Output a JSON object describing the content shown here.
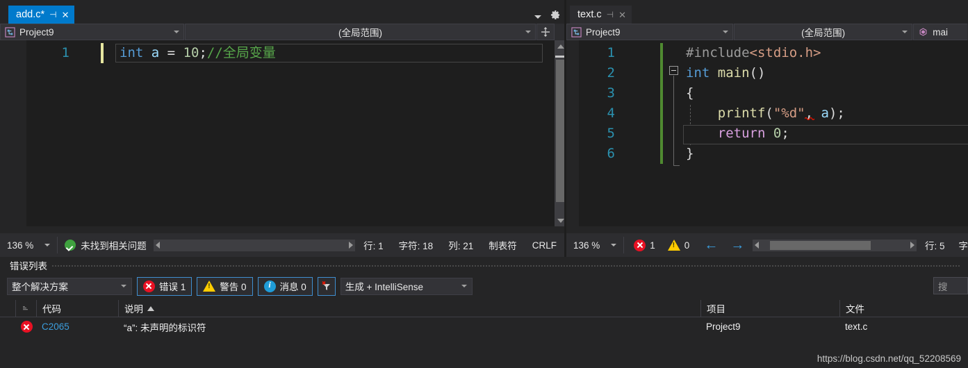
{
  "panes": {
    "left": {
      "tab": {
        "label": "add.c*",
        "pin_icon": "pin-icon",
        "close_icon": "close-icon"
      },
      "navbar": {
        "project": "Project9",
        "scope": "(全局范围)",
        "project_icon": "project-icon",
        "split_icon": "split-view-icon"
      },
      "header_icons": {
        "tab_list": "chevron-down-icon",
        "settings": "gear-icon"
      },
      "lines": [
        {
          "num": "1",
          "tokens": [
            {
              "t": "int",
              "c": "kw"
            },
            {
              "t": " ",
              "c": "plain"
            },
            {
              "t": "a",
              "c": "id"
            },
            {
              "t": " = ",
              "c": "punc"
            },
            {
              "t": "10",
              "c": "num"
            },
            {
              "t": ";",
              "c": "punc"
            },
            {
              "t": "//全局变量",
              "c": "cmt"
            }
          ]
        }
      ],
      "status": {
        "zoom": "136 %",
        "health_icon": "check-circle-icon",
        "health_text": "未找到相关问题",
        "line": "行: 1",
        "char": "字符: 18",
        "col": "列: 21",
        "indent": "制表符",
        "eol": "CRLF"
      }
    },
    "right": {
      "tab": {
        "label": "text.c",
        "pin_icon": "pin-icon",
        "close_icon": "close-icon"
      },
      "navbar": {
        "project": "Project9",
        "scope": "(全局范围)",
        "member": "mai",
        "project_icon": "project-icon",
        "member_icon": "method-icon"
      },
      "lines": [
        {
          "num": "1",
          "indent": 0,
          "tokens": [
            {
              "t": "#include",
              "c": "pre"
            },
            {
              "t": "<stdio.h>",
              "c": "str"
            }
          ]
        },
        {
          "num": "2",
          "indent": 0,
          "tokens": [
            {
              "t": "int",
              "c": "kw"
            },
            {
              "t": " ",
              "c": "plain"
            },
            {
              "t": "main",
              "c": "fn"
            },
            {
              "t": "()",
              "c": "punc"
            }
          ]
        },
        {
          "num": "3",
          "indent": 0,
          "tokens": [
            {
              "t": "{",
              "c": "punc"
            }
          ]
        },
        {
          "num": "4",
          "indent": 2,
          "tokens": [
            {
              "t": "printf",
              "c": "fn"
            },
            {
              "t": "(",
              "c": "punc"
            },
            {
              "t": "\"%d\"",
              "c": "str"
            },
            {
              "t": ", ",
              "c": "punc"
            },
            {
              "t": "a",
              "c": "id"
            },
            {
              "t": ");",
              "c": "punc"
            }
          ]
        },
        {
          "num": "5",
          "indent": 2,
          "tokens": [
            {
              "t": "return",
              "c": "kw2"
            },
            {
              "t": " ",
              "c": "plain"
            },
            {
              "t": "0",
              "c": "num"
            },
            {
              "t": ";",
              "c": "punc"
            }
          ]
        },
        {
          "num": "6",
          "indent": 0,
          "tokens": [
            {
              "t": "}",
              "c": "punc"
            }
          ]
        }
      ],
      "status": {
        "zoom": "136 %",
        "error_icon": "error-icon",
        "error_count": "1",
        "warning_icon": "warning-icon",
        "warning_count": "0",
        "back_icon": "arrow-left-icon",
        "forward_icon": "arrow-right-icon",
        "line": "行: 5",
        "char": "字"
      }
    }
  },
  "error_list": {
    "title": "错误列表",
    "toolbar": {
      "scope": "整个解决方案",
      "errors": {
        "icon": "error-icon",
        "label": "错误 1"
      },
      "warnings": {
        "icon": "warning-icon",
        "label": "警告 0"
      },
      "messages": {
        "icon": "info-icon",
        "label": "消息 0"
      },
      "filter_icon": "clear-filter-icon",
      "build_filter": "生成 + IntelliSense",
      "search_placeholder": "搜"
    },
    "columns": [
      "",
      "",
      "代码",
      "说明",
      "项目",
      "文件"
    ],
    "sort_column": "说明",
    "sort_direction": "asc",
    "rows": [
      {
        "severity_icon": "error-icon",
        "code": "C2065",
        "description": "“a”: 未声明的标识符",
        "project": "Project9",
        "file": "text.c"
      }
    ]
  },
  "watermark": "https://blog.csdn.net/qq_52208569",
  "colors": {
    "accent": "#007acc",
    "error": "#e81123",
    "warning": "#ffcc00",
    "info": "#1f9cd8",
    "ok": "#3fa23f",
    "link": "#3b9ddd"
  }
}
